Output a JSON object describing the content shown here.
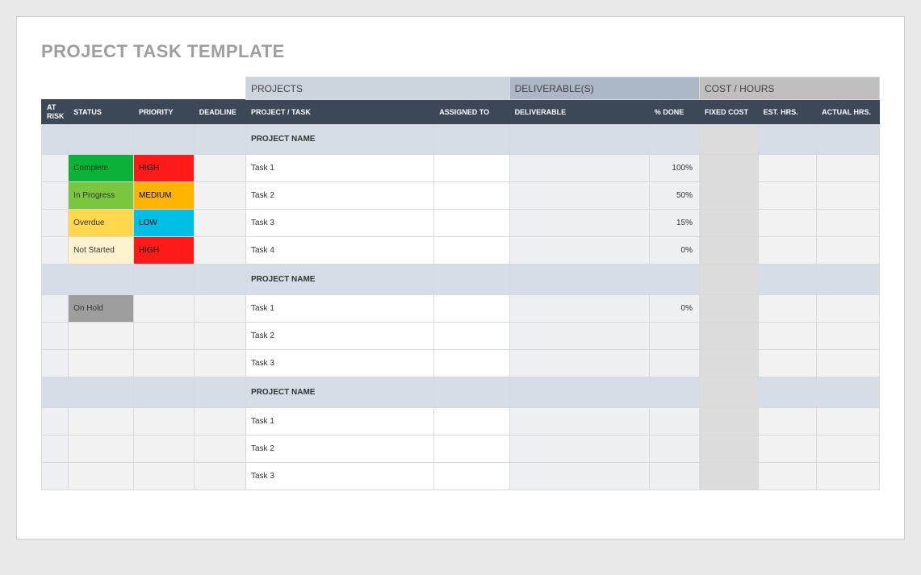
{
  "title": "PROJECT TASK TEMPLATE",
  "bands": {
    "projects": "PROJECTS",
    "deliverables": "DELIVERABLE(S)",
    "cost": "COST / HOURS"
  },
  "columns": {
    "atrisk": "AT RISK",
    "status": "STATUS",
    "priority": "PRIORITY",
    "deadline": "DEADLINE",
    "project": "PROJECT / TASK",
    "assigned": "ASSIGNED TO",
    "deliverable": "DELIVERABLE",
    "done": "% DONE",
    "fixed": "FIXED COST",
    "esth": "EST. HRS.",
    "acth": "ACTUAL HRS."
  },
  "status_colors": {
    "Complete": "status-complete",
    "In Progress": "status-inprogress",
    "Overdue": "status-overdue",
    "Not Started": "status-notstarted",
    "On Hold": "status-onhold"
  },
  "priority_colors": {
    "HIGH": "prio-high",
    "MEDIUM": "prio-medium",
    "LOW": "prio-low"
  },
  "groups": [
    {
      "header": "PROJECT NAME",
      "rows": [
        {
          "status": "Complete",
          "priority": "HIGH",
          "task": "Task 1",
          "done": "100%"
        },
        {
          "status": "In Progress",
          "priority": "MEDIUM",
          "task": "Task 2",
          "done": "50%"
        },
        {
          "status": "Overdue",
          "priority": "LOW",
          "task": "Task 3",
          "done": "15%"
        },
        {
          "status": "Not Started",
          "priority": "HIGH",
          "task": "Task 4",
          "done": "0%"
        }
      ]
    },
    {
      "header": "PROJECT NAME",
      "rows": [
        {
          "status": "On Hold",
          "priority": "",
          "task": "Task 1",
          "done": "0%"
        },
        {
          "status": "",
          "priority": "",
          "task": "Task 2",
          "done": ""
        },
        {
          "status": "",
          "priority": "",
          "task": "Task 3",
          "done": ""
        }
      ]
    },
    {
      "header": "PROJECT NAME",
      "rows": [
        {
          "status": "",
          "priority": "",
          "task": "Task 1",
          "done": ""
        },
        {
          "status": "",
          "priority": "",
          "task": "Task 2",
          "done": ""
        },
        {
          "status": "",
          "priority": "",
          "task": "Task 3",
          "done": ""
        }
      ]
    }
  ]
}
